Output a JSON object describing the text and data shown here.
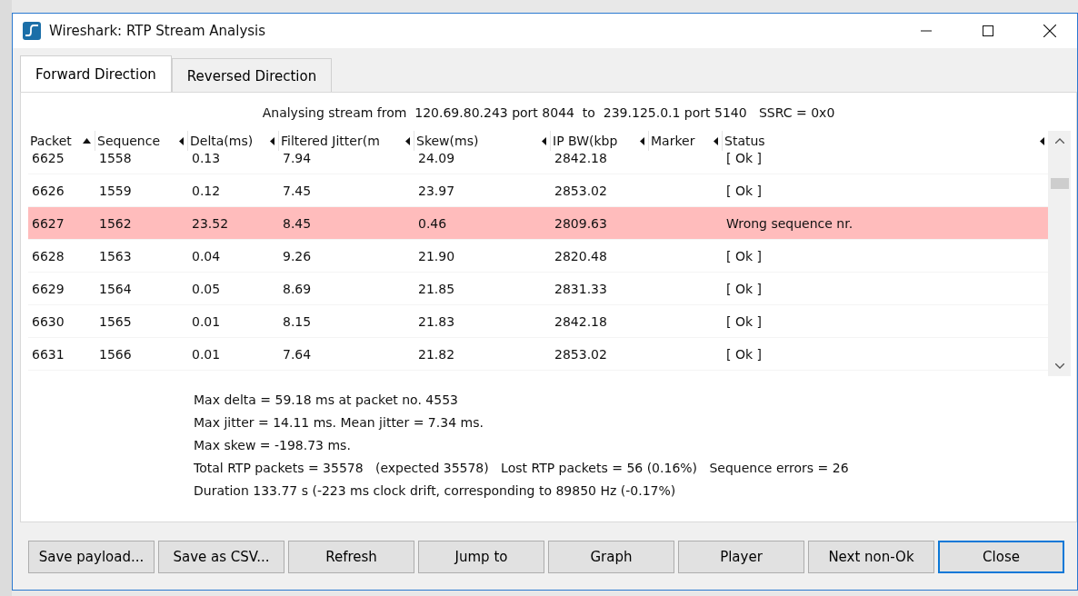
{
  "window": {
    "title": "Wireshark: RTP Stream Analysis"
  },
  "tabs": [
    {
      "label": "Forward Direction",
      "selected": true
    },
    {
      "label": "Reversed Direction",
      "selected": false
    }
  ],
  "stream_info": "Analysing stream from  120.69.80.243 port 8044  to  239.125.0.1 port 5140   SSRC = 0x0",
  "table": {
    "columns": [
      {
        "label": "Packet",
        "sorted": true
      },
      {
        "label": "Sequence",
        "sorted": false
      },
      {
        "label": "Delta(ms)",
        "sorted": false
      },
      {
        "label": "Filtered Jitter(m",
        "sorted": false
      },
      {
        "label": "Skew(ms)",
        "sorted": false
      },
      {
        "label": "IP BW(kbp",
        "sorted": false
      },
      {
        "label": "Marker",
        "sorted": false
      },
      {
        "label": "Status",
        "sorted": false
      }
    ],
    "rows": [
      {
        "cells": [
          "6625",
          "1558",
          "0.13",
          "7.94",
          "24.09",
          "2842.18",
          "",
          "[ Ok ]"
        ],
        "highlighted": false
      },
      {
        "cells": [
          "6626",
          "1559",
          "0.12",
          "7.45",
          "23.97",
          "2853.02",
          "",
          "[ Ok ]"
        ],
        "highlighted": false
      },
      {
        "cells": [
          "6627",
          "1562",
          "23.52",
          "8.45",
          "0.46",
          "2809.63",
          "",
          "Wrong sequence nr."
        ],
        "highlighted": true
      },
      {
        "cells": [
          "6628",
          "1563",
          "0.04",
          "9.26",
          "21.90",
          "2820.48",
          "",
          "[ Ok ]"
        ],
        "highlighted": false
      },
      {
        "cells": [
          "6629",
          "1564",
          "0.05",
          "8.69",
          "21.85",
          "2831.33",
          "",
          "[ Ok ]"
        ],
        "highlighted": false
      },
      {
        "cells": [
          "6630",
          "1565",
          "0.01",
          "8.15",
          "21.83",
          "2842.18",
          "",
          "[ Ok ]"
        ],
        "highlighted": false
      },
      {
        "cells": [
          "6631",
          "1566",
          "0.01",
          "7.64",
          "21.82",
          "2853.02",
          "",
          "[ Ok ]"
        ],
        "highlighted": false
      }
    ]
  },
  "summary": [
    "Max delta = 59.18 ms at packet no. 4553",
    "Max jitter = 14.11 ms. Mean jitter = 7.34 ms.",
    "Max skew = -198.73 ms.",
    "Total RTP packets = 35578   (expected 35578)   Lost RTP packets = 56 (0.16%)   Sequence errors = 26",
    "Duration 133.77 s (-223 ms clock drift, corresponding to 89850 Hz (-0.17%)"
  ],
  "buttons": [
    {
      "label": "Save payload...",
      "default": false
    },
    {
      "label": "Save as CSV...",
      "default": false
    },
    {
      "label": "Refresh",
      "default": false
    },
    {
      "label": "Jump to",
      "default": false
    },
    {
      "label": "Graph",
      "default": false
    },
    {
      "label": "Player",
      "default": false
    },
    {
      "label": "Next non-Ok",
      "default": false
    },
    {
      "label": "Close",
      "default": true
    }
  ]
}
